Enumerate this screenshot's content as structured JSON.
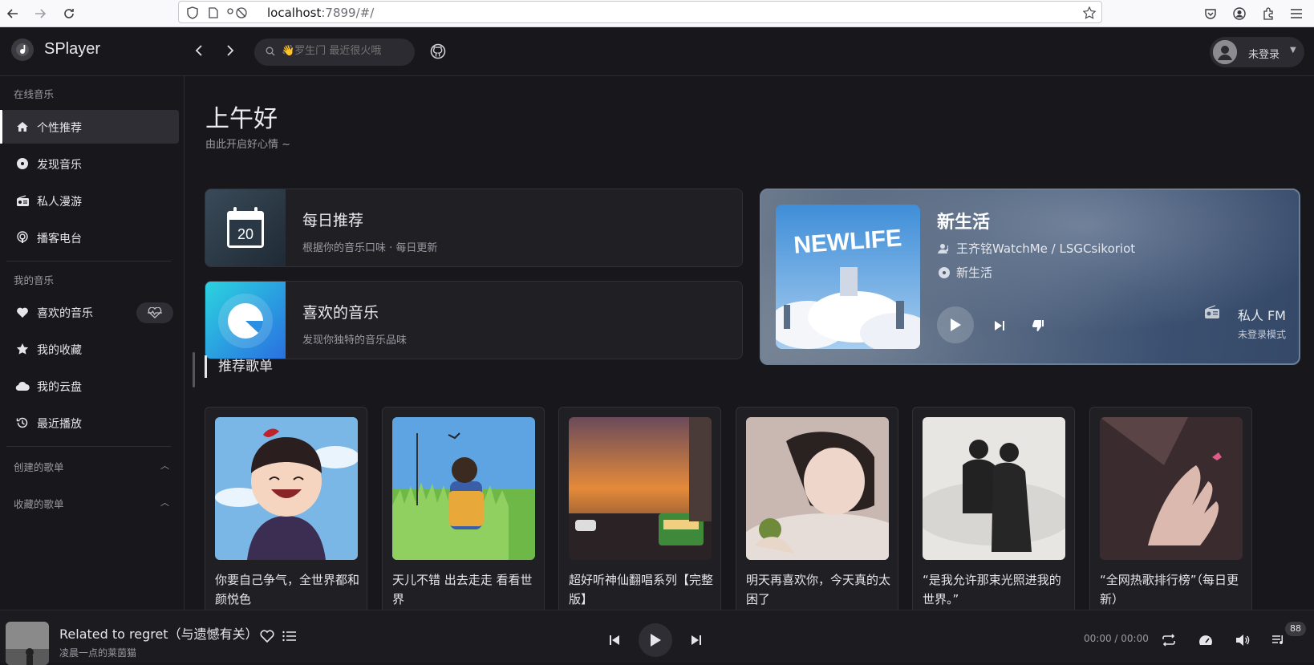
{
  "browser": {
    "url_host": "localhost",
    "url_rest": ":7899/#/"
  },
  "app": {
    "name": "SPlayer",
    "search_placeholder": "👋罗生门 最近很火哦",
    "user_label": "未登录"
  },
  "sidebar": {
    "online_section": "在线音乐",
    "online_items": [
      {
        "label": "个性推荐",
        "icon": "home-icon",
        "active": true
      },
      {
        "label": "发现音乐",
        "icon": "disc-icon"
      },
      {
        "label": "私人漫游",
        "icon": "radio-icon"
      },
      {
        "label": "播客电台",
        "icon": "podcast-icon"
      }
    ],
    "my_section": "我的音乐",
    "my_items": [
      {
        "label": "喜欢的音乐",
        "icon": "heart-icon"
      },
      {
        "label": "我的收藏",
        "icon": "star-icon"
      },
      {
        "label": "我的云盘",
        "icon": "cloud-icon"
      },
      {
        "label": "最近播放",
        "icon": "history-icon"
      }
    ],
    "created_playlists": "创建的歌单",
    "collected_playlists": "收藏的歌单"
  },
  "main": {
    "greeting": "上午好",
    "greeting_sub": "由此开启好心情 ~",
    "daily": {
      "title": "每日推荐",
      "desc": "根据你的音乐口味 · 每日更新",
      "day": "20"
    },
    "liked": {
      "title": "喜欢的音乐",
      "desc": "发现你独特的音乐品味"
    },
    "fm": {
      "title": "新生活",
      "artist": "王齐铭WatchMe / LSGCsikoriot",
      "album": "新生活",
      "label": "私人 FM",
      "mode": "未登录模式",
      "cover_text": "NEWLIFE"
    },
    "playlist_section": "推荐歌单",
    "playlists": [
      {
        "title": "你要自己争气，全世界都和颜悦色"
      },
      {
        "title": "天儿不错 出去走走 看看世界"
      },
      {
        "title": "超好听神仙翻唱系列【完整版】"
      },
      {
        "title": "明天再喜欢你，今天真的太困了"
      },
      {
        "title": "“是我允许那束光照进我的世界。”"
      },
      {
        "title": "“全网热歌排行榜”（每日更新）"
      }
    ]
  },
  "player": {
    "song": "Related to regret（与遗憾有关）",
    "artist": "凌晨一点的莱茵猫",
    "time": "00:00 / 00:00",
    "queue_count": "88"
  }
}
